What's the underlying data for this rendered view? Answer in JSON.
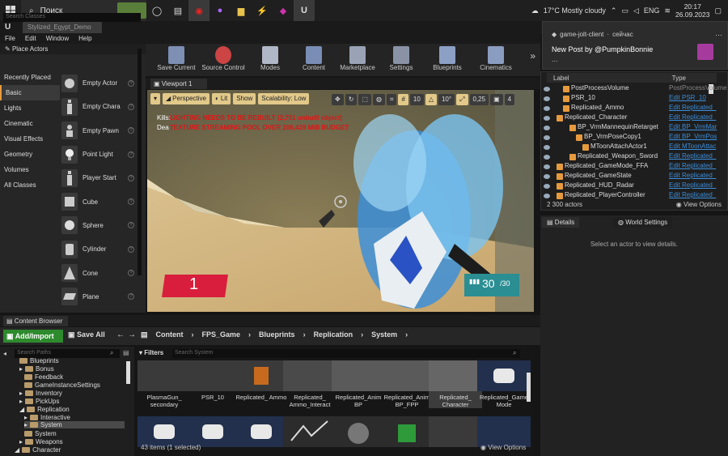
{
  "taskbar": {
    "search_label": "Поиск",
    "weather": "17°C  Mostly cloudy",
    "lang": "ENG",
    "time": "20:17",
    "date": "26.09.2023"
  },
  "editor": {
    "document_tab": "Stylized_Egypt_Demo",
    "menu": [
      "File",
      "Edit",
      "Window",
      "Help"
    ]
  },
  "place_actors": {
    "tab_label": "Place Actors",
    "search_placeholder": "Search Classes",
    "categories": [
      "Recently Placed",
      "Basic",
      "Lights",
      "Cinematic",
      "Visual Effects",
      "Geometry",
      "Volumes",
      "All Classes"
    ],
    "selected_category": "Basic",
    "items": [
      "Empty Actor",
      "Empty Chara",
      "Empty Pawn",
      "Point Light",
      "Player Start",
      "Cube",
      "Sphere",
      "Cylinder",
      "Cone",
      "Plane"
    ]
  },
  "toolbar": {
    "buttons": [
      "Save Current",
      "Source Control",
      "Modes",
      "Content",
      "Marketplace",
      "Settings",
      "Blueprints",
      "Cinematics"
    ]
  },
  "viewport": {
    "tab_label": "Viewport 1",
    "perspective": "Perspective",
    "lit": "Lit",
    "show": "Show",
    "scalability": "Scalability: Low",
    "grid_snap": "10",
    "rot_snap": "10°",
    "scale_snap": "0,25",
    "cam_speed": "4",
    "kills_label": "Kills:",
    "deaths_label": "Dea",
    "warning1": "LIGHTING NEEDS TO BE REBUILT (2,751 unbuilt object)",
    "warning2": "TEXTURE STREAMING POOL OVER 206,429 MiB BUDGET",
    "hud_count": "1",
    "ammo": "30",
    "ammo_max": "/30"
  },
  "content_browser": {
    "tab_label": "Content Browser",
    "add_import": "Add/Import",
    "save_all": "Save All",
    "breadcrumbs": [
      "Content",
      "FPS_Game",
      "Blueprints",
      "Replication",
      "System"
    ],
    "search_paths_placeholder": "Search Paths",
    "filters": "Filters",
    "search_placeholder": "Search System",
    "tree": [
      "Blueprints",
      "Bonus",
      "Feedback",
      "GameInstanceSettings",
      "Inventory",
      "PickUps",
      "Replication",
      "Interactive",
      "System",
      "System",
      "Weapons",
      "Character"
    ],
    "assets": [
      "PlasmaGun_ secondary",
      "PSR_10",
      "Replicated_ Ammo",
      "Replicated_ Ammo_Interact",
      "Replicated_Anim BP",
      "Replicated_Anim BP_FPP",
      "Replicated_ Character",
      "Replicated_Game Mode"
    ],
    "status": "43 items (1 selected)",
    "view_options": "View Options"
  },
  "notification": {
    "app": "game-jolt-client",
    "when": "сейчас",
    "title": "New Post by @PumpkinBonnie",
    "body": "..."
  },
  "outliner": {
    "col_label": "Label",
    "col_type": "Type",
    "rows": [
      {
        "name": "PostProcessVolume",
        "type": "PostProcessVolume",
        "link": false
      },
      {
        "name": "PSR_10",
        "type": "Edit PSR_10",
        "link": true
      },
      {
        "name": "Replicated_Ammo",
        "type": "Edit Replicated_",
        "link": true
      },
      {
        "name": "Replicated_Character",
        "type": "Edit Replicated_",
        "link": true
      },
      {
        "name": "BP_VrmMannequinRetarget",
        "type": "Edit BP_VrmMar",
        "link": true
      },
      {
        "name": "BP_VrmPoseCopy1",
        "type": "Edit BP_VrmPos",
        "link": true
      },
      {
        "name": "MToonAttachActor1",
        "type": "Edit MToonAttac",
        "link": true
      },
      {
        "name": "Replicated_Weapon_Sword",
        "type": "Edit Replicated_",
        "link": true
      },
      {
        "name": "Replicated_GameMode_FFA",
        "type": "Edit Replicated_",
        "link": true
      },
      {
        "name": "Replicated_GameState",
        "type": "Edit Replicated_",
        "link": true
      },
      {
        "name": "Replicated_HUD_Radar",
        "type": "Edit Replicated_",
        "link": true
      },
      {
        "name": "Replicated_PlayerController",
        "type": "Edit Replicated_",
        "link": true
      }
    ],
    "actor_count": "2 300 actors",
    "view_options": "View Options"
  },
  "details": {
    "tab1": "Details",
    "tab2": "World Settings",
    "empty": "Select an actor to view details."
  },
  "colors": {
    "accent": "#e69a3e",
    "link": "#3c8ed9",
    "warning": "#e01515",
    "add_button": "#2d8a2d"
  }
}
